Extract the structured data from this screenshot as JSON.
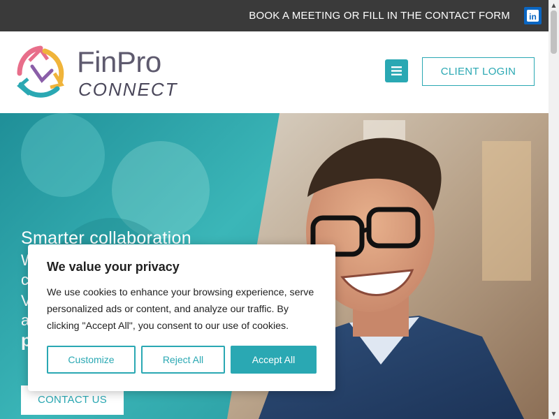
{
  "topbar": {
    "cta_link": "BOOK A MEETING OR FILL IN THE CONTACT FORM",
    "social_icon": "linkedin-icon",
    "linkedin_glyph": "in"
  },
  "header": {
    "logo_word1": "FinPro",
    "logo_word2": "CONNECT",
    "menu_icon": "hamburger-icon",
    "login_label": "CLIENT LOGIN"
  },
  "hero": {
    "heading_line1": "Smarter collaboration",
    "partial_lines": [
      "W",
      "c",
      "V",
      "a",
      "p"
    ],
    "contact_label": "CONTACT US"
  },
  "cookie_banner": {
    "title": "We value your privacy",
    "body": "We use cookies to enhance your browsing experience, serve personalized ads or content, and analyze our traffic. By clicking \"Accept All\", you consent to our use of cookies.",
    "customize_label": "Customize",
    "reject_label": "Reject All",
    "accept_label": "Accept All"
  },
  "colors": {
    "accent": "#2aa8b3",
    "topbar_bg": "#3a3a3a",
    "linkedin": "#0a66c2"
  }
}
